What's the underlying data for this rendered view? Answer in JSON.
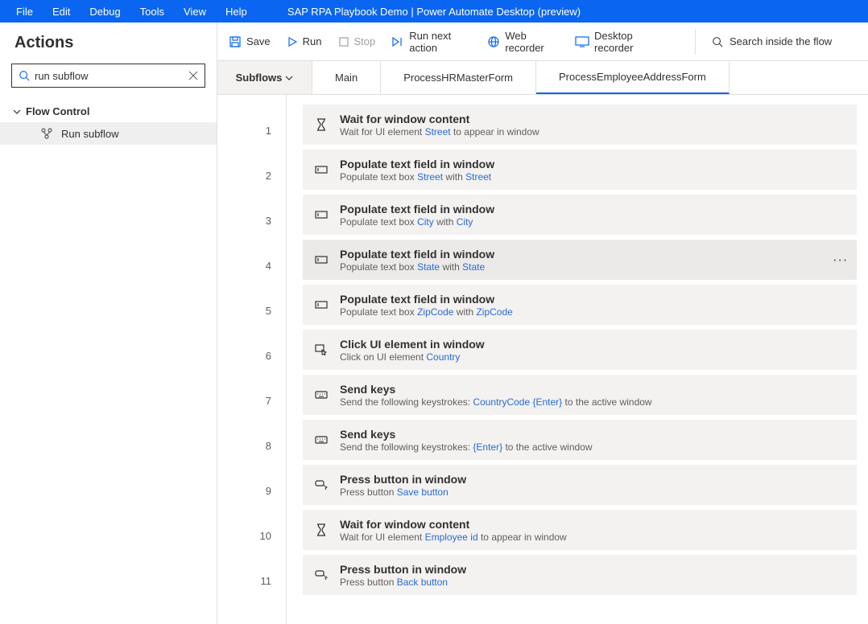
{
  "window_title": "SAP RPA Playbook Demo | Power Automate Desktop (preview)",
  "menus": {
    "file": "File",
    "edit": "Edit",
    "debug": "Debug",
    "tools": "Tools",
    "view": "View",
    "help": "Help"
  },
  "sidebar": {
    "title": "Actions",
    "search_value": "run subflow",
    "group": "Flow Control",
    "item": "Run subflow"
  },
  "toolbar": {
    "save": "Save",
    "run": "Run",
    "stop": "Stop",
    "run_next": "Run next action",
    "web_recorder": "Web recorder",
    "desktop_recorder": "Desktop recorder",
    "search_flow": "Search inside the flow"
  },
  "tabs": {
    "subflows": "Subflows",
    "main": "Main",
    "t2": "ProcessHRMasterForm",
    "t3": "ProcessEmployeeAddressForm"
  },
  "rows": [
    {
      "n": "1",
      "title": "Wait for window content",
      "desc_pre": "Wait for UI element ",
      "desc_link": "Street",
      "desc_post": " to appear in window"
    },
    {
      "n": "2",
      "title": "Populate text field in window",
      "desc_pre": "Populate text box ",
      "l1": "Street",
      "mid": " with   ",
      "l2": "Street"
    },
    {
      "n": "3",
      "title": "Populate text field in window",
      "desc_pre": "Populate text box ",
      "l1": "City",
      "mid": " with   ",
      "l2": "City"
    },
    {
      "n": "4",
      "title": "Populate text field in window",
      "desc_pre": "Populate text box ",
      "l1": "State",
      "mid": " with   ",
      "l2": "State"
    },
    {
      "n": "5",
      "title": "Populate text field in window",
      "desc_pre": "Populate text box ",
      "l1": "ZipCode",
      "mid": " with   ",
      "l2": "ZipCode"
    },
    {
      "n": "6",
      "title": "Click UI element in window",
      "desc_pre": "Click on UI element ",
      "desc_link": "Country",
      "desc_post": ""
    },
    {
      "n": "7",
      "title": "Send keys",
      "desc_pre": "Send the following keystrokes:   ",
      "l1": "CountryCode",
      "mid": "  ",
      "l2": "{Enter}",
      "desc_post": " to the active window"
    },
    {
      "n": "8",
      "title": "Send keys",
      "desc_pre": "Send the following keystrokes: ",
      "desc_link": "{Enter}",
      "desc_post": " to the active window"
    },
    {
      "n": "9",
      "title": "Press button in window",
      "desc_pre": "Press button ",
      "desc_link": "Save button",
      "desc_post": ""
    },
    {
      "n": "10",
      "title": "Wait for window content",
      "desc_pre": "Wait for UI element ",
      "desc_link": "Employee id",
      "desc_post": " to appear in window"
    },
    {
      "n": "11",
      "title": "Press button in window",
      "desc_pre": "Press button ",
      "desc_link": "Back button",
      "desc_post": ""
    }
  ]
}
